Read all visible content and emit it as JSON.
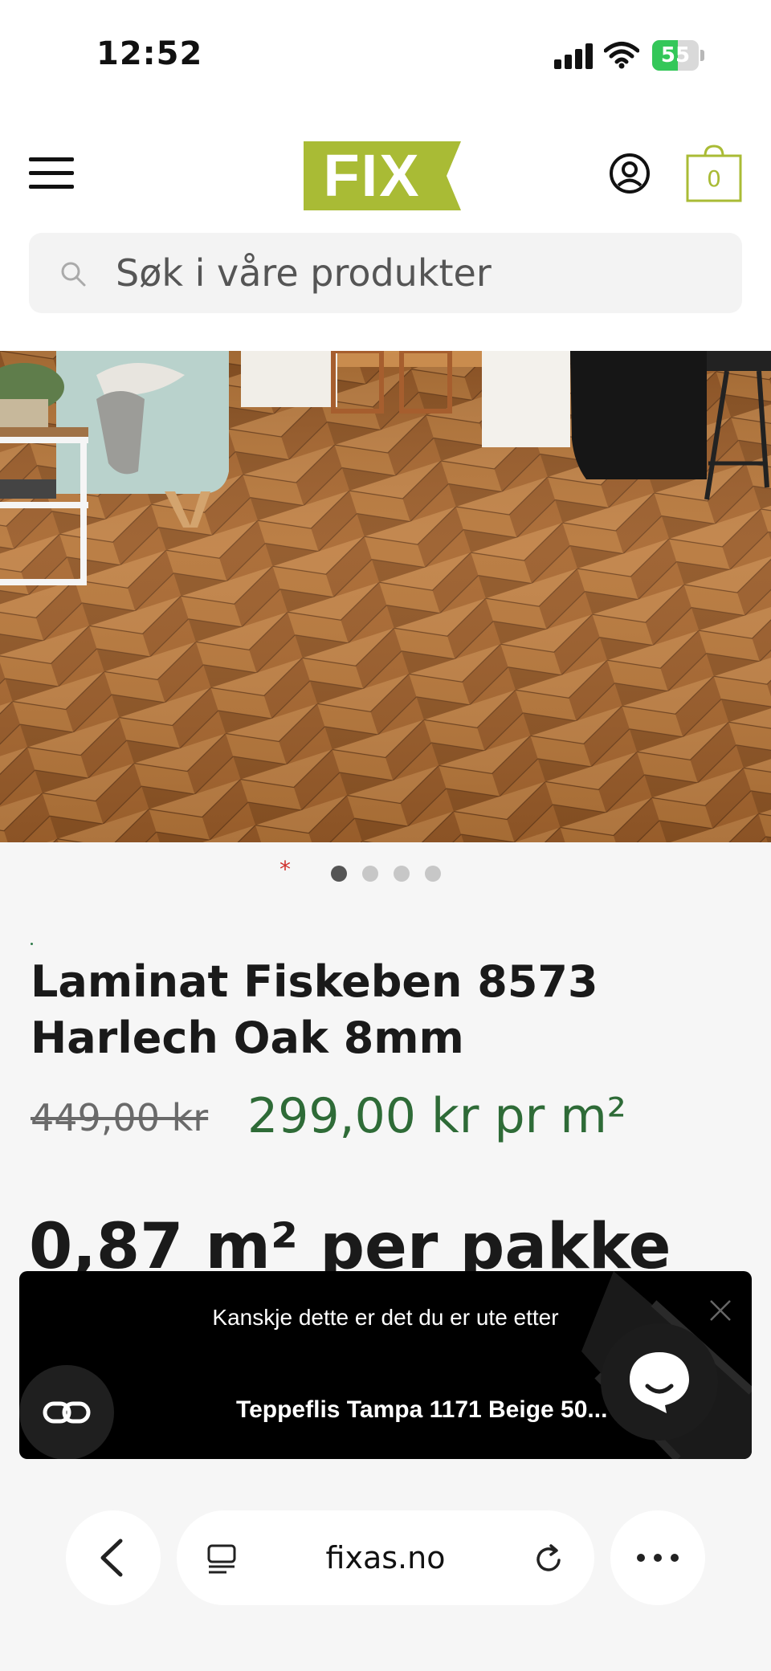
{
  "status_bar": {
    "time": "12:52",
    "battery": "55"
  },
  "header": {
    "logo": "FIX",
    "cart_count": "0"
  },
  "search": {
    "placeholder": "Søk i våre produkter"
  },
  "carousel": {
    "slide_count": 4,
    "active_index": 0,
    "asterisk": "*"
  },
  "product": {
    "title_line1": "Laminat Fiskeben 8573",
    "title_line2": "Harlech Oak 8mm",
    "old_price": "449,00 kr",
    "new_price": "299,00 kr pr m²",
    "per_pack": "0,87 m² per pakke"
  },
  "popup": {
    "heading": "Kanskje dette er det du er ute etter",
    "product": "Teppeflis Tampa 1171 Beige 50..."
  },
  "browser": {
    "address": "fixas.no"
  },
  "colors": {
    "brand": "#a9bb35",
    "price_green": "#2e6b37",
    "old_price": "#6a6a6a",
    "battery_green": "#34c759"
  },
  "icons": [
    "menu-icon",
    "account-icon",
    "cart-icon",
    "search-icon",
    "close-icon",
    "link-icon",
    "chat-icon",
    "back-icon",
    "tabs-icon",
    "reload-icon",
    "more-icon",
    "signal-icon",
    "wifi-icon",
    "battery-icon"
  ]
}
